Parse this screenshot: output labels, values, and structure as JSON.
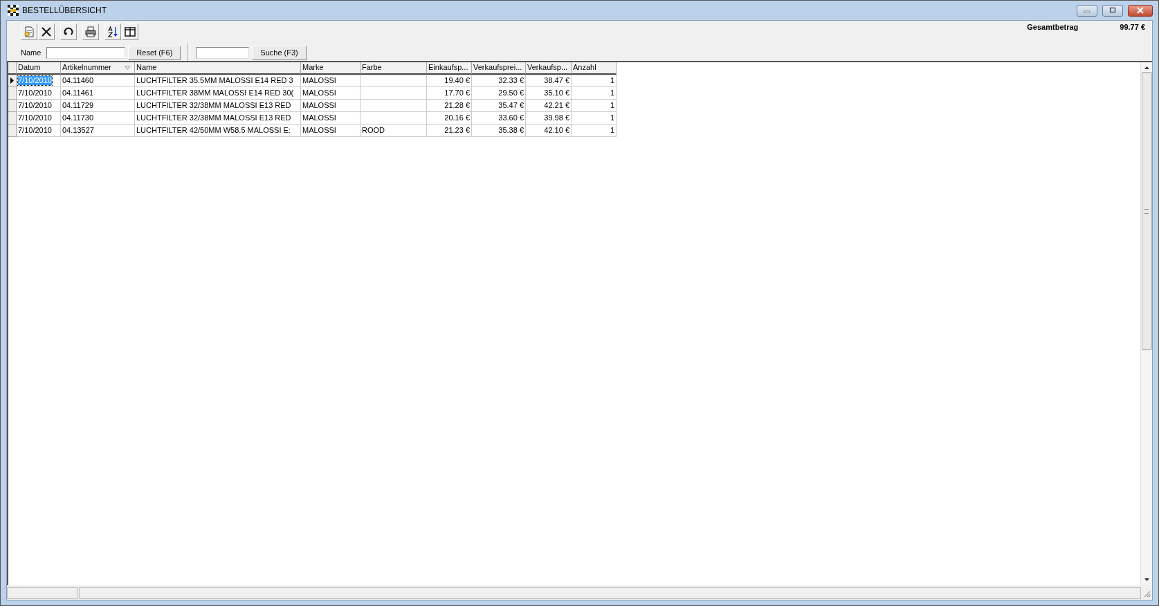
{
  "window": {
    "title": "BESTELLÜBERSICHT"
  },
  "summary": {
    "label": "Gesamtbetrag",
    "value": "99.77 €"
  },
  "filter": {
    "name_label": "Name",
    "reset_button": "Reset (F6)",
    "search_button": "Suche (F3)"
  },
  "table": {
    "columns": [
      {
        "label": "Datum",
        "sorted": false
      },
      {
        "label": "Artikelnummer",
        "sorted": true
      },
      {
        "label": "Name",
        "sorted": false
      },
      {
        "label": "Marke",
        "sorted": false
      },
      {
        "label": "Farbe",
        "sorted": false
      },
      {
        "label": "Einkaufsp...",
        "sorted": false
      },
      {
        "label": "Verkaufsprei...",
        "sorted": false
      },
      {
        "label": "Verkaufsp...",
        "sorted": false
      },
      {
        "label": "Anzahl",
        "sorted": false
      }
    ],
    "rows": [
      {
        "selected": true,
        "cells": [
          "7/10/2010",
          "04.11460",
          "LUCHTFILTER 35.5MM MALOSSI E14 RED 3",
          "MALOSSI",
          "",
          "19.40 €",
          "32.33 €",
          "38.47 €",
          "1"
        ]
      },
      {
        "selected": false,
        "cells": [
          "7/10/2010",
          "04.11461",
          "LUCHTFILTER 38MM MALOSSI E14 RED 30(",
          "MALOSSI",
          "",
          "17.70 €",
          "29.50 €",
          "35.10 €",
          "1"
        ]
      },
      {
        "selected": false,
        "cells": [
          "7/10/2010",
          "04.11729",
          "LUCHTFILTER 32/38MM MALOSSI E13 RED",
          "MALOSSI",
          "",
          "21.28 €",
          "35.47 €",
          "42.21 €",
          "1"
        ]
      },
      {
        "selected": false,
        "cells": [
          "7/10/2010",
          "04.11730",
          "LUCHTFILTER 32/38MM MALOSSI E13 RED",
          "MALOSSI",
          "",
          "20.16 €",
          "33.60 €",
          "39.98 €",
          "1"
        ]
      },
      {
        "selected": false,
        "cells": [
          "7/10/2010",
          "04.13527",
          "LUCHTFILTER 42/50MM W58.5 MALOSSI E:",
          "MALOSSI",
          "ROOD",
          "21.23 €",
          "35.38 €",
          "42.10 €",
          "1"
        ]
      }
    ]
  }
}
